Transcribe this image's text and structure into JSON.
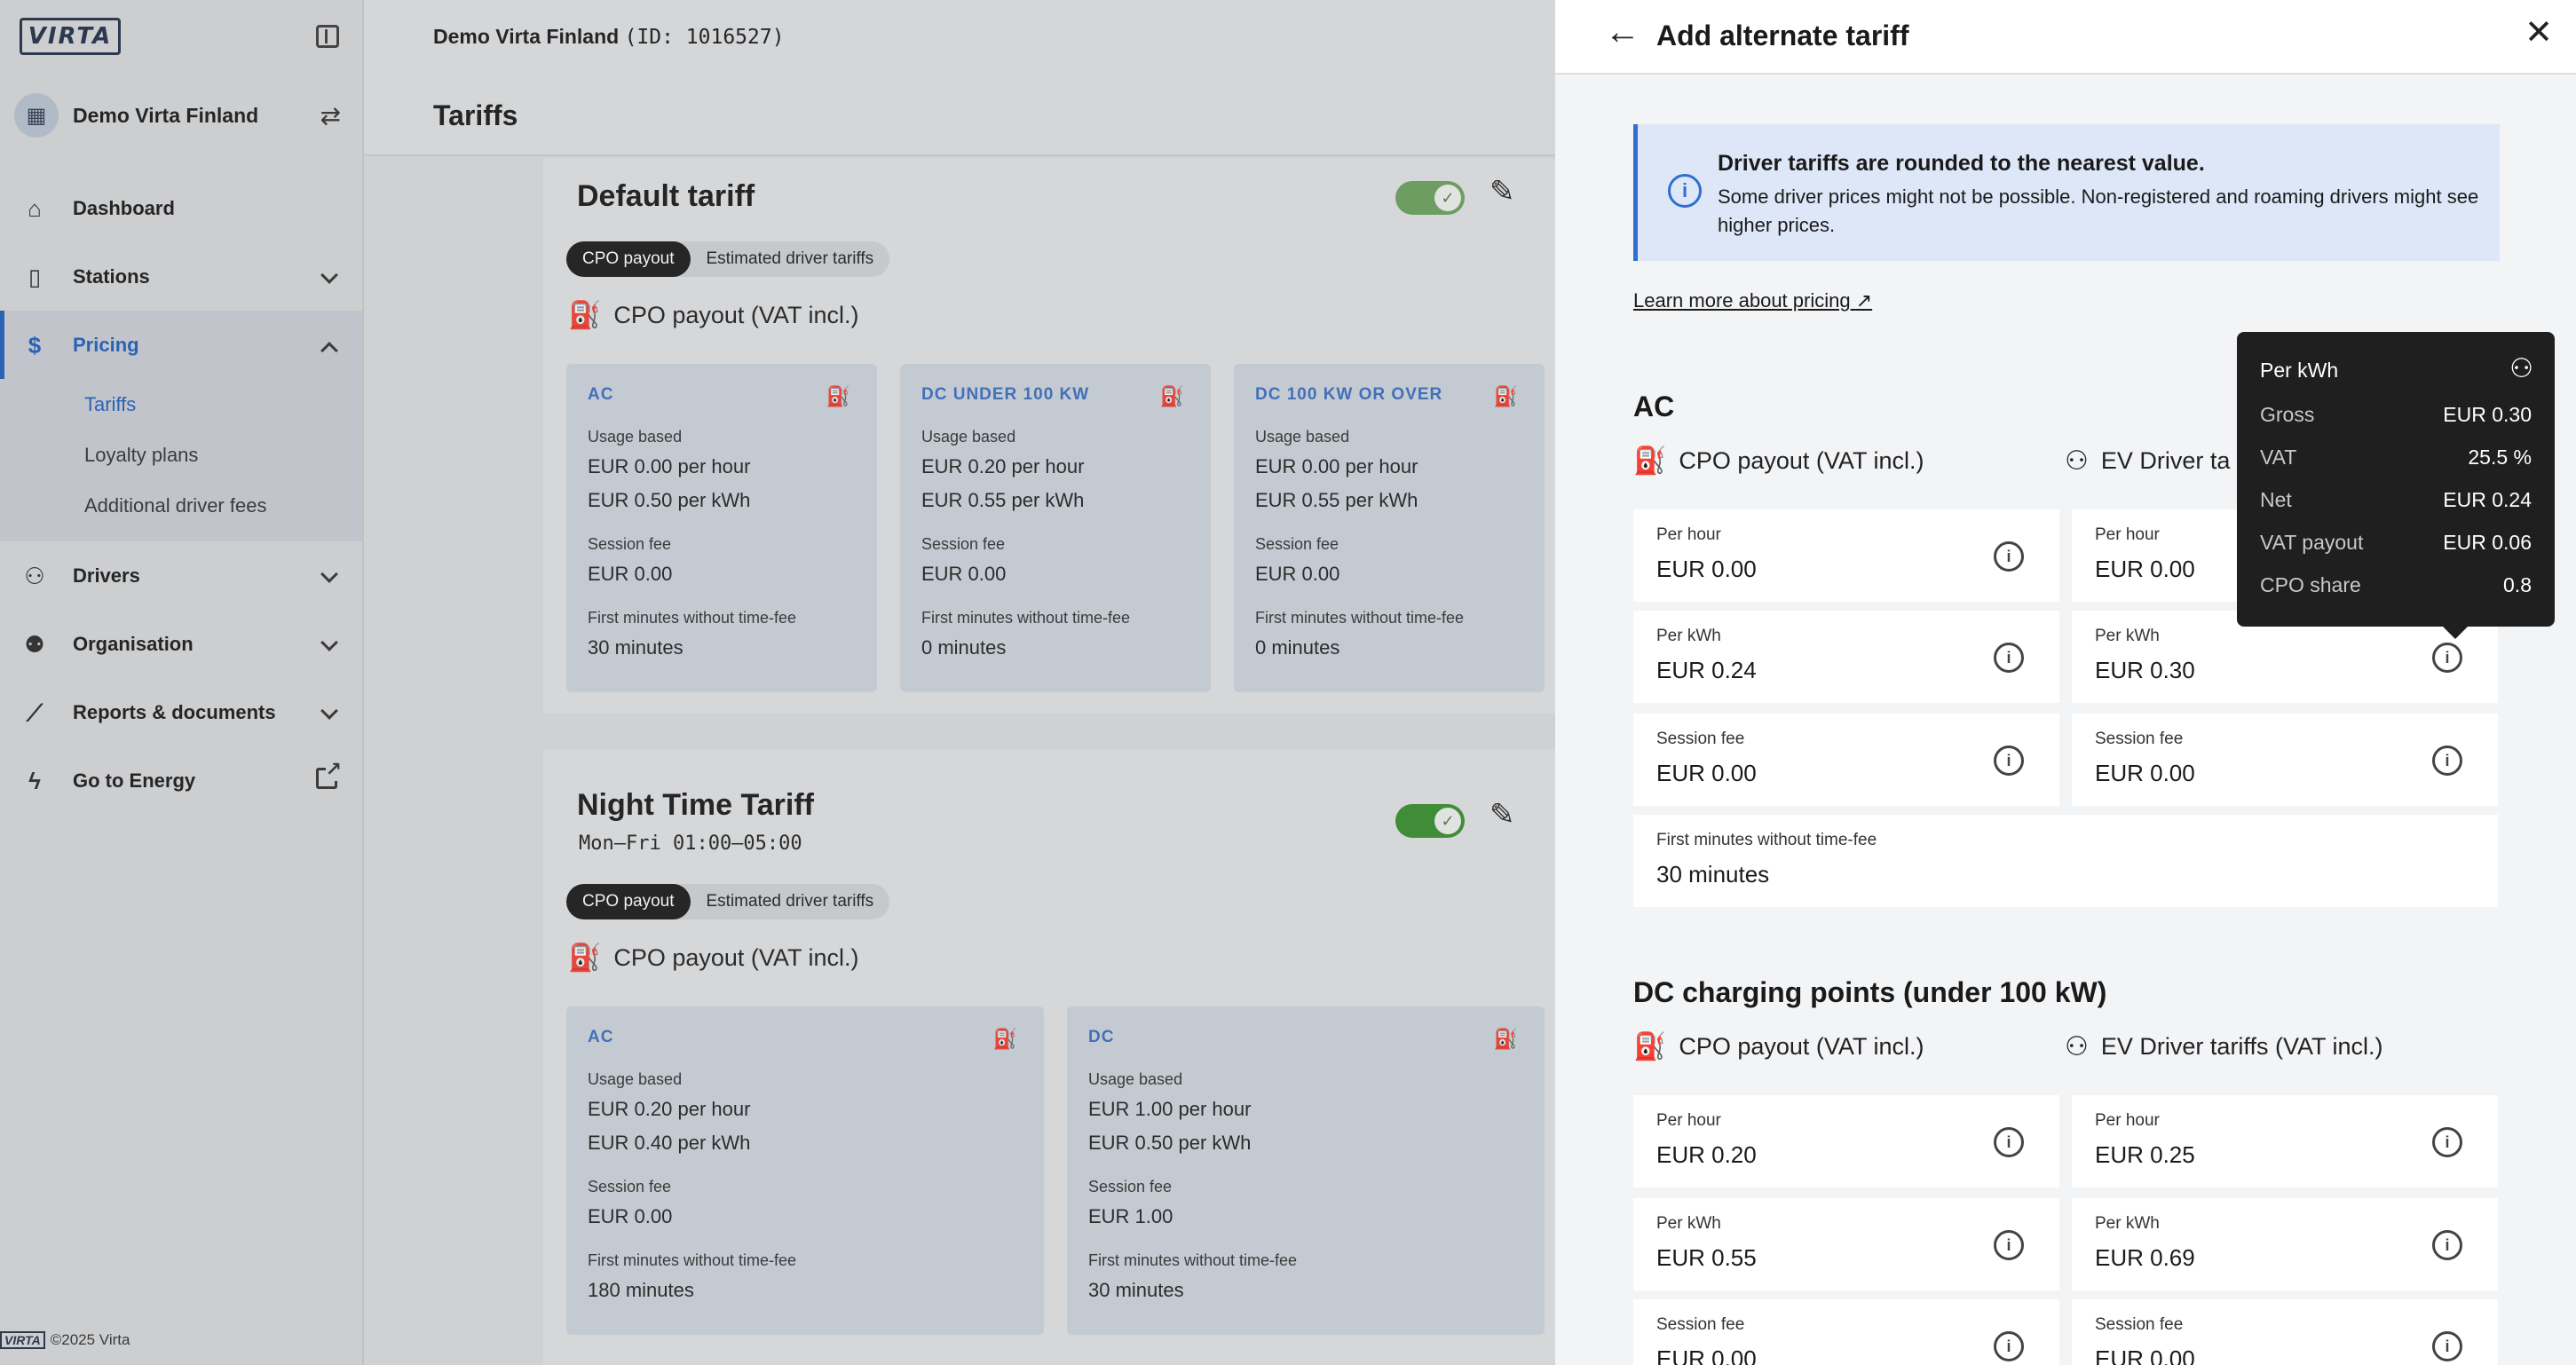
{
  "sidebar": {
    "logo": "VIRTA",
    "org_name": "Demo Virta Finland",
    "nav": {
      "dashboard": "Dashboard",
      "stations": "Stations",
      "pricing": "Pricing",
      "tariffs": "Tariffs",
      "loyalty": "Loyalty plans",
      "driver_fees": "Additional driver fees",
      "drivers": "Drivers",
      "organisation": "Organisation",
      "reports": "Reports & documents",
      "energy": "Go to Energy"
    },
    "copyright_logo": "VIRTA",
    "copyright": "©2025 Virta"
  },
  "header": {
    "org": "Demo Virta Finland",
    "org_id": "(ID: 1016527)",
    "page_title": "Tariffs"
  },
  "default_tariff": {
    "title": "Default tariff",
    "seg_cpo": "CPO payout",
    "seg_driver": "Estimated driver tariffs",
    "section": "CPO payout (VAT incl.)",
    "cards": [
      {
        "title": "AC",
        "usage_label": "Usage based",
        "per_hour": "EUR 0.00 per hour",
        "per_kwh": "EUR 0.50 per kWh",
        "session_label": "Session fee",
        "session": "EUR 0.00",
        "first_label": "First minutes without time-fee",
        "first": "30 minutes"
      },
      {
        "title": "DC UNDER 100 KW",
        "usage_label": "Usage based",
        "per_hour": "EUR 0.20 per hour",
        "per_kwh": "EUR 0.55 per kWh",
        "session_label": "Session fee",
        "session": "EUR 0.00",
        "first_label": "First minutes without time-fee",
        "first": "0 minutes"
      },
      {
        "title": "DC 100 KW OR OVER",
        "usage_label": "Usage based",
        "per_hour": "EUR 0.00 per hour",
        "per_kwh": "EUR 0.55 per kWh",
        "session_label": "Session fee",
        "session": "EUR 0.00",
        "first_label": "First minutes without time-fee",
        "first": "0 minutes"
      }
    ]
  },
  "night_tariff": {
    "title": "Night Time Tariff",
    "schedule": "Mon—Fri 01:00—05:00",
    "seg_cpo": "CPO payout",
    "seg_driver": "Estimated driver tariffs",
    "section": "CPO payout (VAT incl.)",
    "cards": [
      {
        "title": "AC",
        "usage_label": "Usage based",
        "per_hour": "EUR 0.20 per hour",
        "per_kwh": "EUR 0.40 per kWh",
        "session_label": "Session fee",
        "session": "EUR 0.00",
        "first_label": "First minutes without time-fee",
        "first": "180 minutes"
      },
      {
        "title": "DC",
        "usage_label": "Usage based",
        "per_hour": "EUR 1.00 per hour",
        "per_kwh": "EUR 0.50 per kWh",
        "session_label": "Session fee",
        "session": "EUR 1.00",
        "first_label": "First minutes without time-fee",
        "first": "30 minutes"
      }
    ]
  },
  "panel": {
    "title": "Add alternate tariff",
    "info_title": "Driver tariffs are rounded to the nearest value.",
    "info_text": "Some driver prices might not be possible. Non-registered and roaming drivers might see higher prices.",
    "learn_more": "Learn more about pricing",
    "ac": {
      "title": "AC",
      "cpo_head": "CPO payout (VAT incl.)",
      "driver_head": "EV Driver ta",
      "per_hour_label": "Per hour",
      "per_kwh_label": "Per kWh",
      "session_label": "Session fee",
      "first_label": "First minutes without time-fee",
      "cpo_per_hour": "EUR 0.00",
      "cpo_per_kwh": "EUR 0.24",
      "cpo_session": "EUR 0.00",
      "drv_per_hour": "EUR 0.00",
      "drv_per_kwh": "EUR 0.30",
      "drv_session": "EUR 0.00",
      "first": "30 minutes"
    },
    "dc": {
      "title": "DC charging points (under 100 kW)",
      "cpo_head": "CPO payout (VAT incl.)",
      "driver_head": "EV Driver tariffs (VAT incl.)",
      "per_hour_label": "Per hour",
      "per_kwh_label": "Per kWh",
      "session_label": "Session fee",
      "cpo_per_hour": "EUR 0.20",
      "cpo_per_kwh": "EUR 0.55",
      "cpo_session": "EUR 0.00",
      "drv_per_hour": "EUR 0.25",
      "drv_per_kwh": "EUR 0.69",
      "drv_session": "EUR 0.00"
    }
  },
  "tooltip": {
    "title": "Per kWh",
    "gross_label": "Gross",
    "gross": "EUR 0.30",
    "vat_label": "VAT",
    "vat": "25.5 %",
    "net_label": "Net",
    "net": "EUR 0.24",
    "vat_payout_label": "VAT payout",
    "vat_payout": "EUR 0.06",
    "cpo_share_label": "CPO share",
    "cpo_share": "0.8"
  }
}
